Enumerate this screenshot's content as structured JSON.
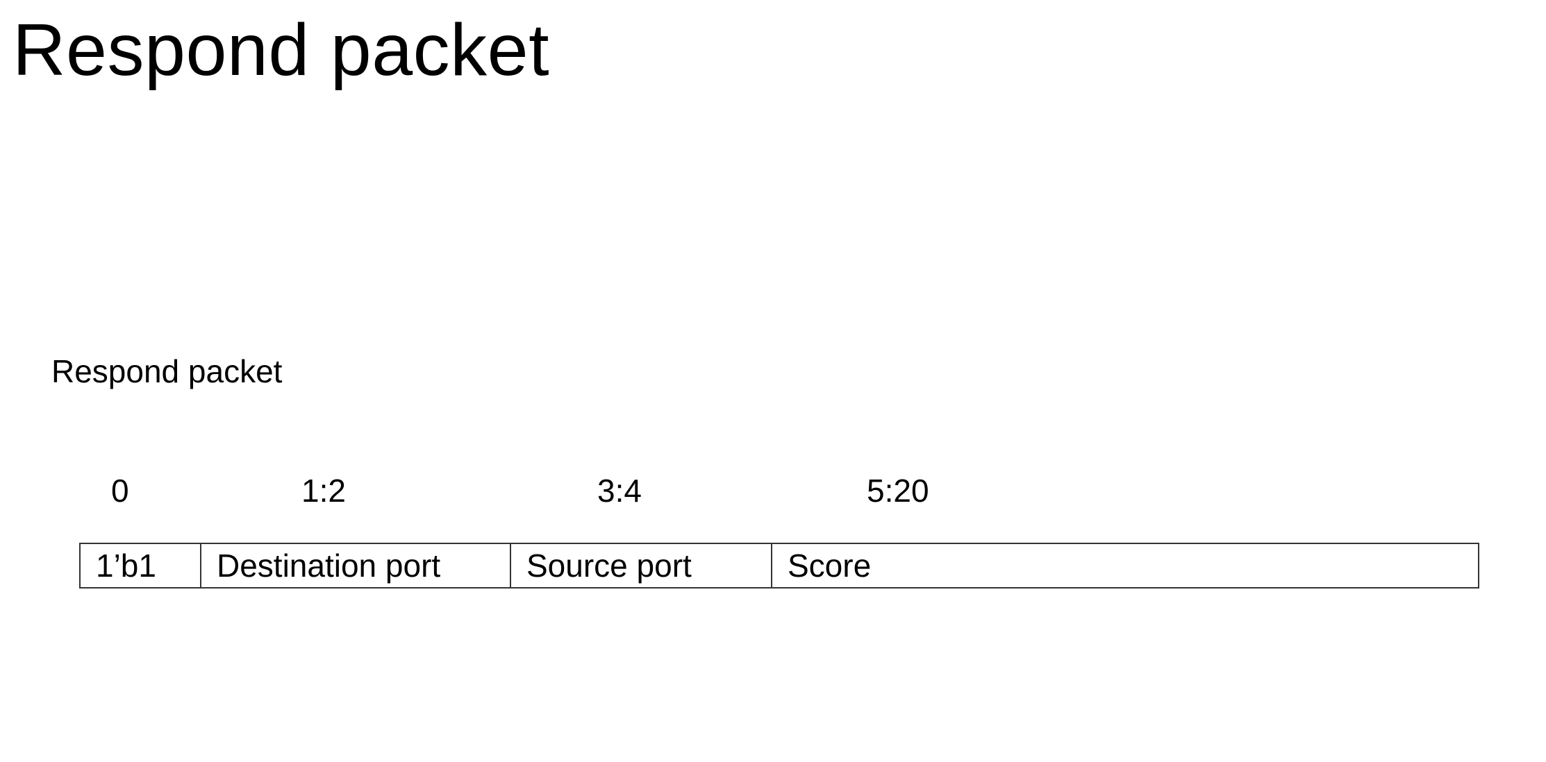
{
  "slide": {
    "title": "Respond packet"
  },
  "diagram": {
    "caption": "Respond packet",
    "bit_ranges": [
      "0",
      "1:2",
      "3:4",
      "5:20"
    ],
    "fields": [
      "1’b1",
      "Destination port",
      "Source port",
      "Score"
    ]
  }
}
